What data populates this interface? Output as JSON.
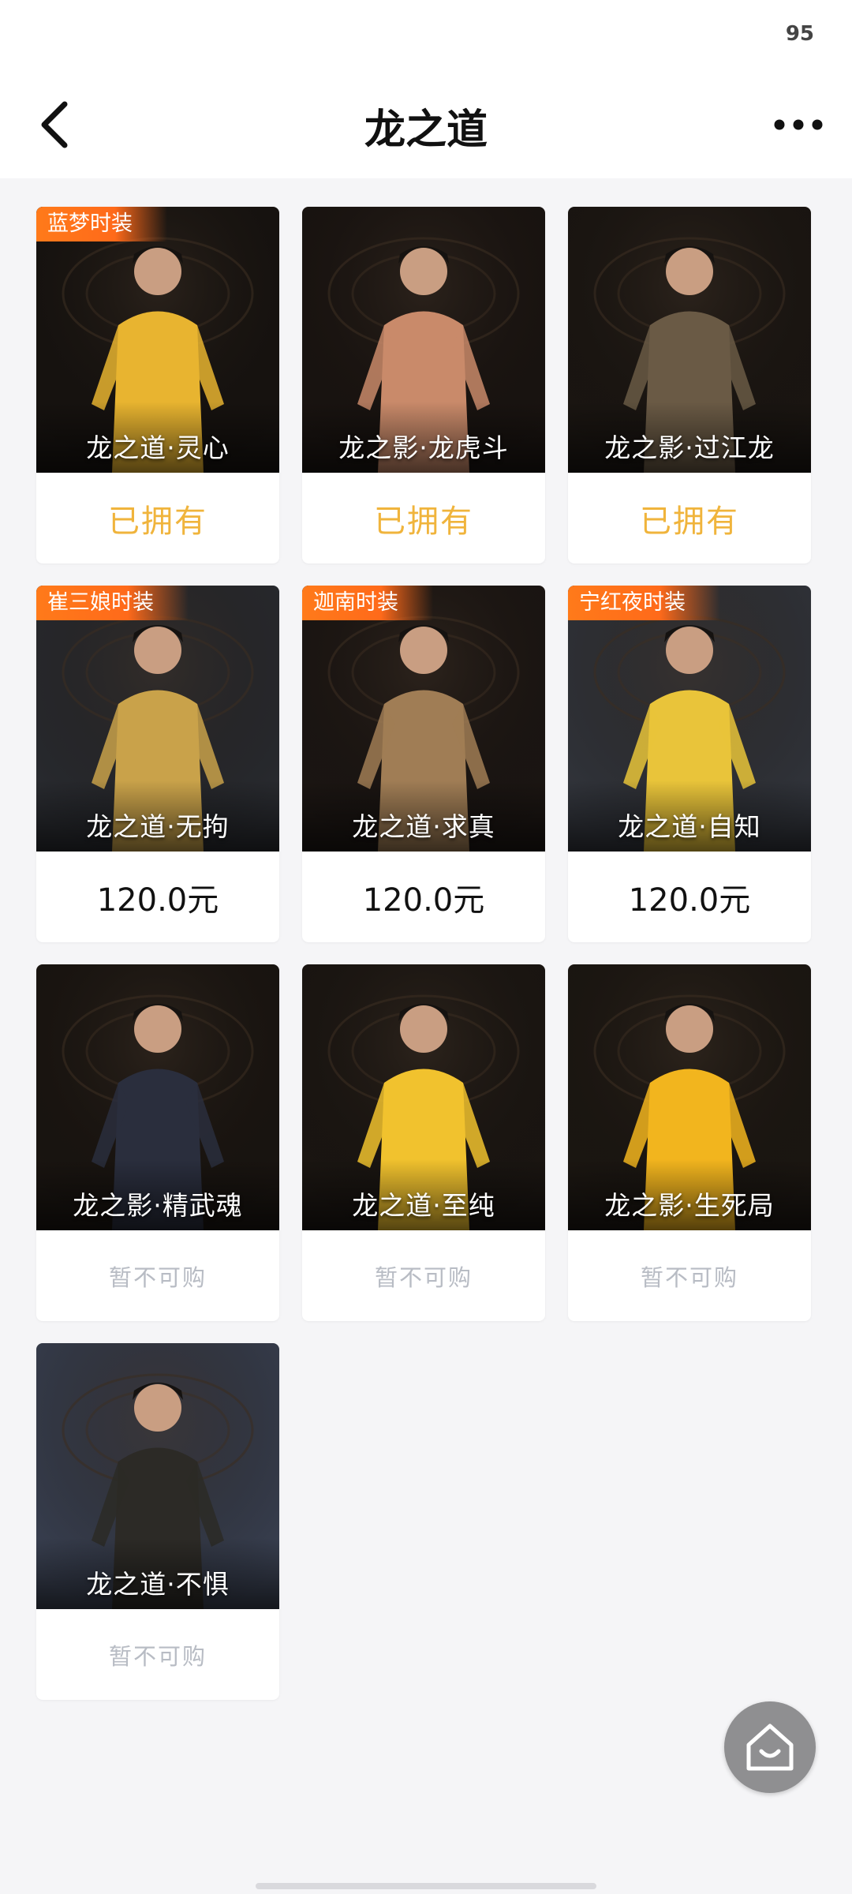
{
  "status_bar": {
    "battery": "95"
  },
  "nav": {
    "title": "龙之道",
    "back_icon": "chevron-left-icon",
    "more_icon": "more-dots-icon"
  },
  "items": [
    {
      "name": "龙之道·灵心",
      "tag": "蓝梦时装",
      "status": "已拥有",
      "status_type": "owned",
      "bg": "#171310",
      "accent": "#e8b430"
    },
    {
      "name": "龙之影·龙虎斗",
      "tag": "",
      "status": "已拥有",
      "status_type": "owned",
      "bg": "#1a1411",
      "accent": "#c98a6a"
    },
    {
      "name": "龙之影·过江龙",
      "tag": "",
      "status": "已拥有",
      "status_type": "owned",
      "bg": "#1b1612",
      "accent": "#6a5a45"
    },
    {
      "name": "龙之道·无拘",
      "tag": "崔三娘时装",
      "status": "120.0元",
      "status_type": "price",
      "bg": "#2a2c31",
      "accent": "#c9a24a"
    },
    {
      "name": "龙之道·求真",
      "tag": "迦南时装",
      "status": "120.0元",
      "status_type": "price",
      "bg": "#1c1613",
      "accent": "#a07d55"
    },
    {
      "name": "龙之道·自知",
      "tag": "宁红夜时装",
      "status": "120.0元",
      "status_type": "price",
      "bg": "#33363d",
      "accent": "#e9c43a"
    },
    {
      "name": "龙之影·精武魂",
      "tag": "",
      "status": "暂不可购",
      "status_type": "unavailable",
      "bg": "#1a1511",
      "accent": "#2a2e3d"
    },
    {
      "name": "龙之道·至纯",
      "tag": "",
      "status": "暂不可购",
      "status_type": "unavailable",
      "bg": "#1b1612",
      "accent": "#f1c22e"
    },
    {
      "name": "龙之影·生死局",
      "tag": "",
      "status": "暂不可购",
      "status_type": "unavailable",
      "bg": "#1c1712",
      "accent": "#f2b51e"
    },
    {
      "name": "龙之道·不惧",
      "tag": "",
      "status": "暂不可购",
      "status_type": "unavailable",
      "bg": "#3a4152",
      "accent": "#2c2a26"
    }
  ],
  "float_button": {
    "icon": "home-icon"
  }
}
